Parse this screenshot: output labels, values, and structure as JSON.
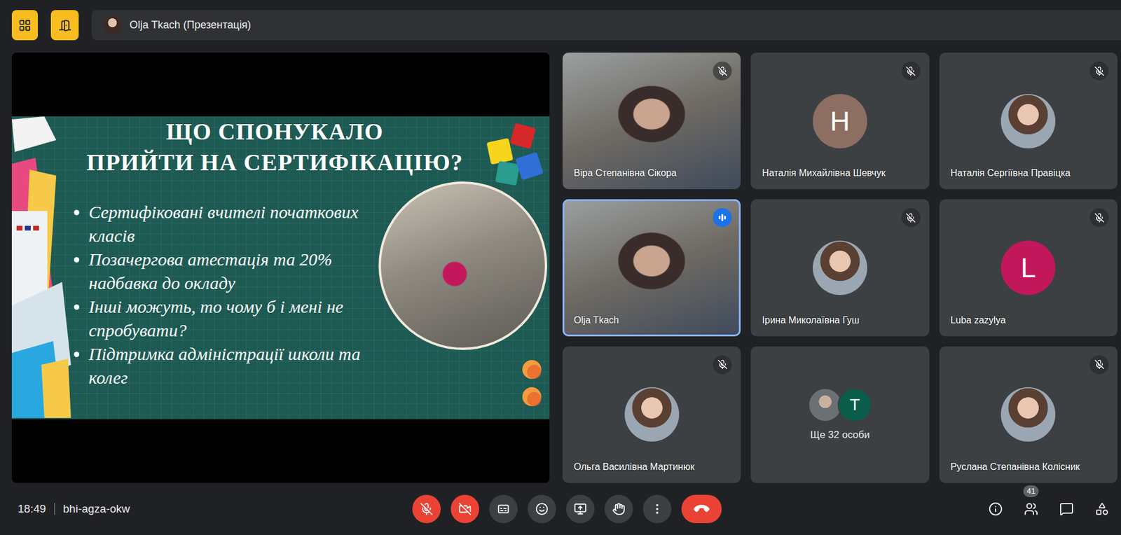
{
  "top_bar": {
    "presenter": "Olja Tkach (Презентація)"
  },
  "presentation": {
    "title_lines": [
      "ЩО СПОНУКАЛО",
      "ПРИЙТИ НА СЕРТИФІКАЦІЮ?"
    ],
    "bullets": [
      "Сертифіковані вчителі початкових класів",
      "Позачергова атестація та 20% надбавка до окладу",
      "Інші можуть, то чому б і мені не спробувати?",
      "Підтримка адміністрації школи та колег"
    ]
  },
  "tiles": [
    {
      "name": "Віра Степанівна Сікора",
      "kind": "video",
      "muted": true,
      "speaking": false
    },
    {
      "name": "Наталія Михайлівна Шевчук",
      "kind": "letter",
      "letter": "Н",
      "color": "#8d6e63",
      "muted": true,
      "speaking": false
    },
    {
      "name": "Наталія Сергіївна Правіцка",
      "kind": "photo",
      "muted": true,
      "speaking": false
    },
    {
      "name": "Olja Tkach",
      "kind": "video",
      "muted": false,
      "speaking": true
    },
    {
      "name": "Ірина Миколаївна Гуш",
      "kind": "photo",
      "muted": true,
      "speaking": false
    },
    {
      "name": "Luba zazylya",
      "kind": "letter",
      "letter": "L",
      "color": "#c2185b",
      "muted": true,
      "speaking": false
    },
    {
      "name": "Ольга Василівна Мартинюк",
      "kind": "photo",
      "muted": true,
      "speaking": false
    },
    {
      "name": "Ще 32 особи",
      "kind": "overflow",
      "muted": false,
      "speaking": false,
      "others": [
        {
          "kind": "photo"
        },
        {
          "kind": "letter",
          "letter": "T",
          "color": "#0b5d4b"
        }
      ]
    },
    {
      "name": "Руслана Степанівна Колісник",
      "kind": "photo",
      "muted": true,
      "speaking": false
    }
  ],
  "bottom_bar": {
    "time": "18:49",
    "meeting_code": "bhi-agza-okw",
    "participants_count": "41",
    "mic_muted": true,
    "camera_off": true
  }
}
